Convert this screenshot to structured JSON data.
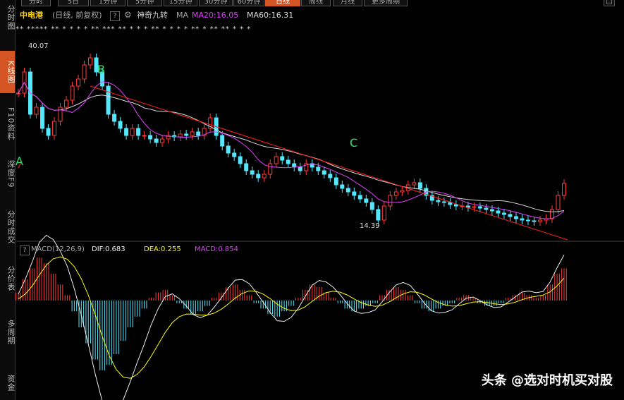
{
  "tabs": [
    "分时",
    "5日",
    "1分钟",
    "5分钟",
    "15分钟",
    "30分钟",
    "60分钟",
    "日线",
    "周线",
    "月线",
    "更多周期"
  ],
  "active_tab_index": 7,
  "sidebar": [
    "分时图",
    "K线图",
    "F10资料",
    "深度F9",
    "分时成交",
    "分价表",
    "多周期",
    "资金"
  ],
  "sidebar_active": 1,
  "stock": {
    "name": "中电港",
    "mode": "(日线, 前复权)",
    "help": "?",
    "indicator": "神奇九转",
    "ma_label": "MA",
    "ma20": "MA20:16.05",
    "ma60": "MA60:16.31"
  },
  "price_high": "40.07",
  "price_low": "14.39",
  "annotations": [
    "A",
    "B",
    "C"
  ],
  "macd": {
    "help": "?",
    "title": "MACD(12,26,9)",
    "dif": "DIF:0.683",
    "dea": "DEA:0.255",
    "macd": "MACD:0.854"
  },
  "star_markers": "** ***** **    * * *   *   ** *** **    * * *            ** *     * * *     ** *  **            **    * * *",
  "watermark": "头条 @选对时机买对股",
  "colors": {
    "up": "#ff3b3b",
    "down": "#54e8ff",
    "ma20": "#e040fb",
    "ma60": "#d8d8d8",
    "dea": "#ffff00",
    "trend": "#ff2020",
    "accent": "#d45424"
  },
  "chart_data": {
    "type": "line",
    "note_price": "candlestick daily K-line chart",
    "ylim": [
      14.39,
      40.07
    ],
    "close_series": [
      33,
      36,
      30,
      31,
      28,
      27,
      29,
      31,
      32,
      34,
      35,
      37,
      38,
      36,
      34,
      30,
      29,
      28,
      27,
      28,
      27,
      27,
      26.5,
      26,
      26.5,
      27,
      26.8,
      27.2,
      27,
      27.5,
      27,
      28,
      29.5,
      27,
      25.5,
      24.5,
      24,
      23,
      22,
      21.5,
      21,
      21.5,
      23,
      24,
      23.5,
      23,
      22.5,
      22,
      23,
      22.5,
      22,
      21.5,
      21,
      20,
      19.5,
      19,
      18.5,
      18,
      17.5,
      16.5,
      15,
      17,
      18.5,
      19,
      19.2,
      20,
      20.3,
      19.5,
      18.5,
      17.8,
      17.6,
      17.5,
      17.2,
      17,
      17,
      16.8,
      16.9,
      16.7,
      16.5,
      16.3,
      16,
      15.8,
      15.5,
      15.2,
      15,
      14.9,
      14.8,
      15,
      15.2,
      16.5,
      18.5,
      20.2
    ],
    "macd_hist": [
      0.3,
      0.8,
      1.2,
      1.6,
      1.4,
      1.0,
      0.6,
      0.2,
      -0.4,
      -1.0,
      -1.6,
      -2.2,
      -2.6,
      -2.4,
      -2.0,
      -1.5,
      -1.0,
      -0.6,
      -0.3,
      0.1,
      0.3,
      0.4,
      0.2,
      -0.1,
      -0.3,
      -0.5,
      -0.4,
      -0.2,
      0.1,
      0.3,
      0.5,
      0.6,
      0.4,
      0.2,
      -0.1,
      -0.3,
      -0.5,
      -0.6,
      -0.4,
      -0.2,
      0.1,
      0.4,
      0.6,
      0.5,
      0.3,
      0.1,
      -0.1,
      -0.3,
      -0.4,
      -0.3,
      -0.2,
      -0.1,
      0.2,
      0.4,
      0.5,
      0.4,
      0.2,
      -0.1,
      -0.3,
      -0.4,
      -0.3,
      -0.2,
      -0.1,
      0.1,
      0.2,
      0.1,
      -0.1,
      -0.2,
      -0.2,
      -0.1,
      0.1,
      0.2,
      0.3,
      0.2,
      0.1,
      0.2,
      0.6,
      1.0,
      1.2
    ]
  }
}
